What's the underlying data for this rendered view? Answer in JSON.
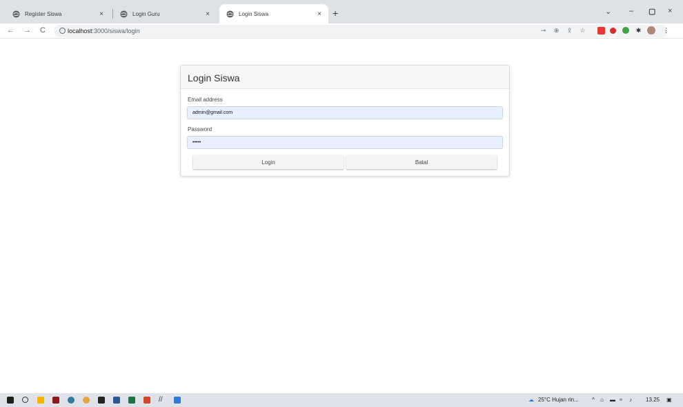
{
  "browser": {
    "tabs": [
      {
        "label": "Register Siswa",
        "close": "×"
      },
      {
        "label": "Login Guru",
        "close": "×"
      },
      {
        "label": "Login Siswa",
        "close": "×"
      }
    ],
    "new_tab": "+",
    "window_controls": {
      "minimize": "–",
      "maximize": "▢",
      "close": "×",
      "dropdown": "⌄"
    },
    "url_host": "localhost",
    "url_path": ":3000/siswa/login",
    "nav": {
      "back": "←",
      "forward": "→",
      "reload": "C"
    },
    "menu": "⋮"
  },
  "form": {
    "title": "Login Siswa",
    "email_label": "Email address",
    "email_value": "admin@gmail.com",
    "password_label": "Password",
    "password_value": "•••••",
    "login_button": "Login",
    "cancel_button": "Batal"
  },
  "taskbar": {
    "weather": "25°C  Hujan rin...",
    "tray_symbols": "^",
    "time": "13.25"
  },
  "colors": {
    "tabstrip": "#dee1e6",
    "autofill": "#e8f0fe",
    "card_header": "#f7f7f7"
  }
}
